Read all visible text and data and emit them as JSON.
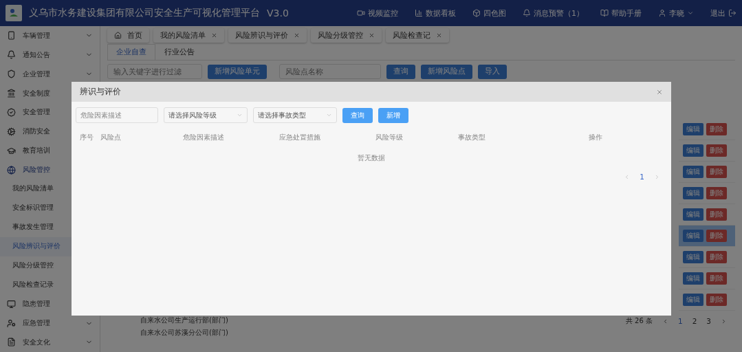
{
  "header": {
    "title": "义乌市水务建设集团有限公司安全生产可视化管理平台",
    "version": "V3.0",
    "nav": [
      {
        "kind": "video",
        "label": "视频监控"
      },
      {
        "kind": "chart",
        "label": "数据看板"
      },
      {
        "kind": "cube",
        "label": "四色图"
      },
      {
        "kind": "bell",
        "label": "消息预警（1）"
      },
      {
        "kind": "book",
        "label": "帮助手册"
      }
    ],
    "user": "李晓",
    "logout": "退出"
  },
  "sidebar": {
    "items": [
      {
        "kind": "phone",
        "label": "车辆管理",
        "expanded": false
      },
      {
        "kind": "bell",
        "label": "通知公告",
        "expanded": false
      },
      {
        "kind": "shield",
        "label": "企业管理",
        "expanded": false
      },
      {
        "kind": "bank",
        "label": "安全制度"
      },
      {
        "kind": "badge",
        "label": "安全管理"
      },
      {
        "kind": "gear",
        "label": "消防安全"
      },
      {
        "kind": "cap",
        "label": "教育培训"
      },
      {
        "kind": "globe",
        "label": "风险管控",
        "expanded": true,
        "children": [
          {
            "label": "我的风险清单",
            "selected": false
          },
          {
            "label": "安全标识管理",
            "selected": false
          },
          {
            "label": "事故发生管理",
            "selected": false
          },
          {
            "label": "风险辨识与评价",
            "selected": true
          },
          {
            "label": "风险分级管控",
            "selected": false
          },
          {
            "label": "风险检查记录",
            "selected": false
          }
        ]
      },
      {
        "kind": "screen",
        "label": "隐患管理"
      },
      {
        "kind": "person",
        "label": "应急管理",
        "expanded": false
      },
      {
        "kind": "doc",
        "label": "安全文化",
        "expanded": false
      }
    ]
  },
  "tabs": [
    {
      "label": "首页",
      "home": true
    },
    {
      "label": "我的风险清单"
    },
    {
      "label": "风险辨识与评价"
    },
    {
      "label": "风险分级管控"
    },
    {
      "label": "风险检查记"
    }
  ],
  "subtabs": [
    {
      "label": "企业自查",
      "selected": true
    },
    {
      "label": "行业公告",
      "selected": false
    }
  ],
  "toolbar": {
    "filter_placeholder": "输入关键字进行过滤",
    "add_unit": "新增风险单元",
    "name_placeholder": "风险点名称",
    "buttons": [
      "查询",
      "新增风险点",
      "导入"
    ]
  },
  "tree": [
    "自来水公司生产运行部(部门)",
    "自来水公司苏溪分公司(部门)"
  ],
  "rows": [
    {
      "edit": "编辑",
      "delete": "删除",
      "selected": false
    },
    {
      "edit": "编辑",
      "delete": "删除",
      "selected": false
    },
    {
      "edit": "编辑",
      "delete": "删除",
      "selected": false
    },
    {
      "edit": "编辑",
      "delete": "删除",
      "selected": false
    },
    {
      "edit": "编辑",
      "delete": "删除",
      "selected": false
    },
    {
      "edit": "编辑",
      "delete": "删除",
      "selected": true
    },
    {
      "edit": "编辑",
      "delete": "删除",
      "selected": false
    },
    {
      "edit": "编辑",
      "delete": "删除",
      "selected": false
    },
    {
      "edit": "编辑",
      "delete": "删除",
      "selected": false
    }
  ],
  "pagination": {
    "total": "共 26 条",
    "pages": [
      {
        "label": "1",
        "selected": true
      },
      {
        "label": "2",
        "selected": false
      },
      {
        "label": "3",
        "selected": false
      }
    ]
  },
  "dialog": {
    "title": "辨识与评价",
    "search_placeholder": "危险因素描述",
    "selects": [
      "请选择风险等级",
      "请选择事故类型"
    ],
    "buttons": [
      "查询",
      "新增"
    ],
    "columns": [
      "序号",
      "风险点",
      "危险因素描述",
      "应急处置措施",
      "风险等级",
      "事故类型",
      "操作"
    ],
    "empty": "暂无数据",
    "pages": [
      {
        "label": "1",
        "selected": true
      }
    ]
  }
}
